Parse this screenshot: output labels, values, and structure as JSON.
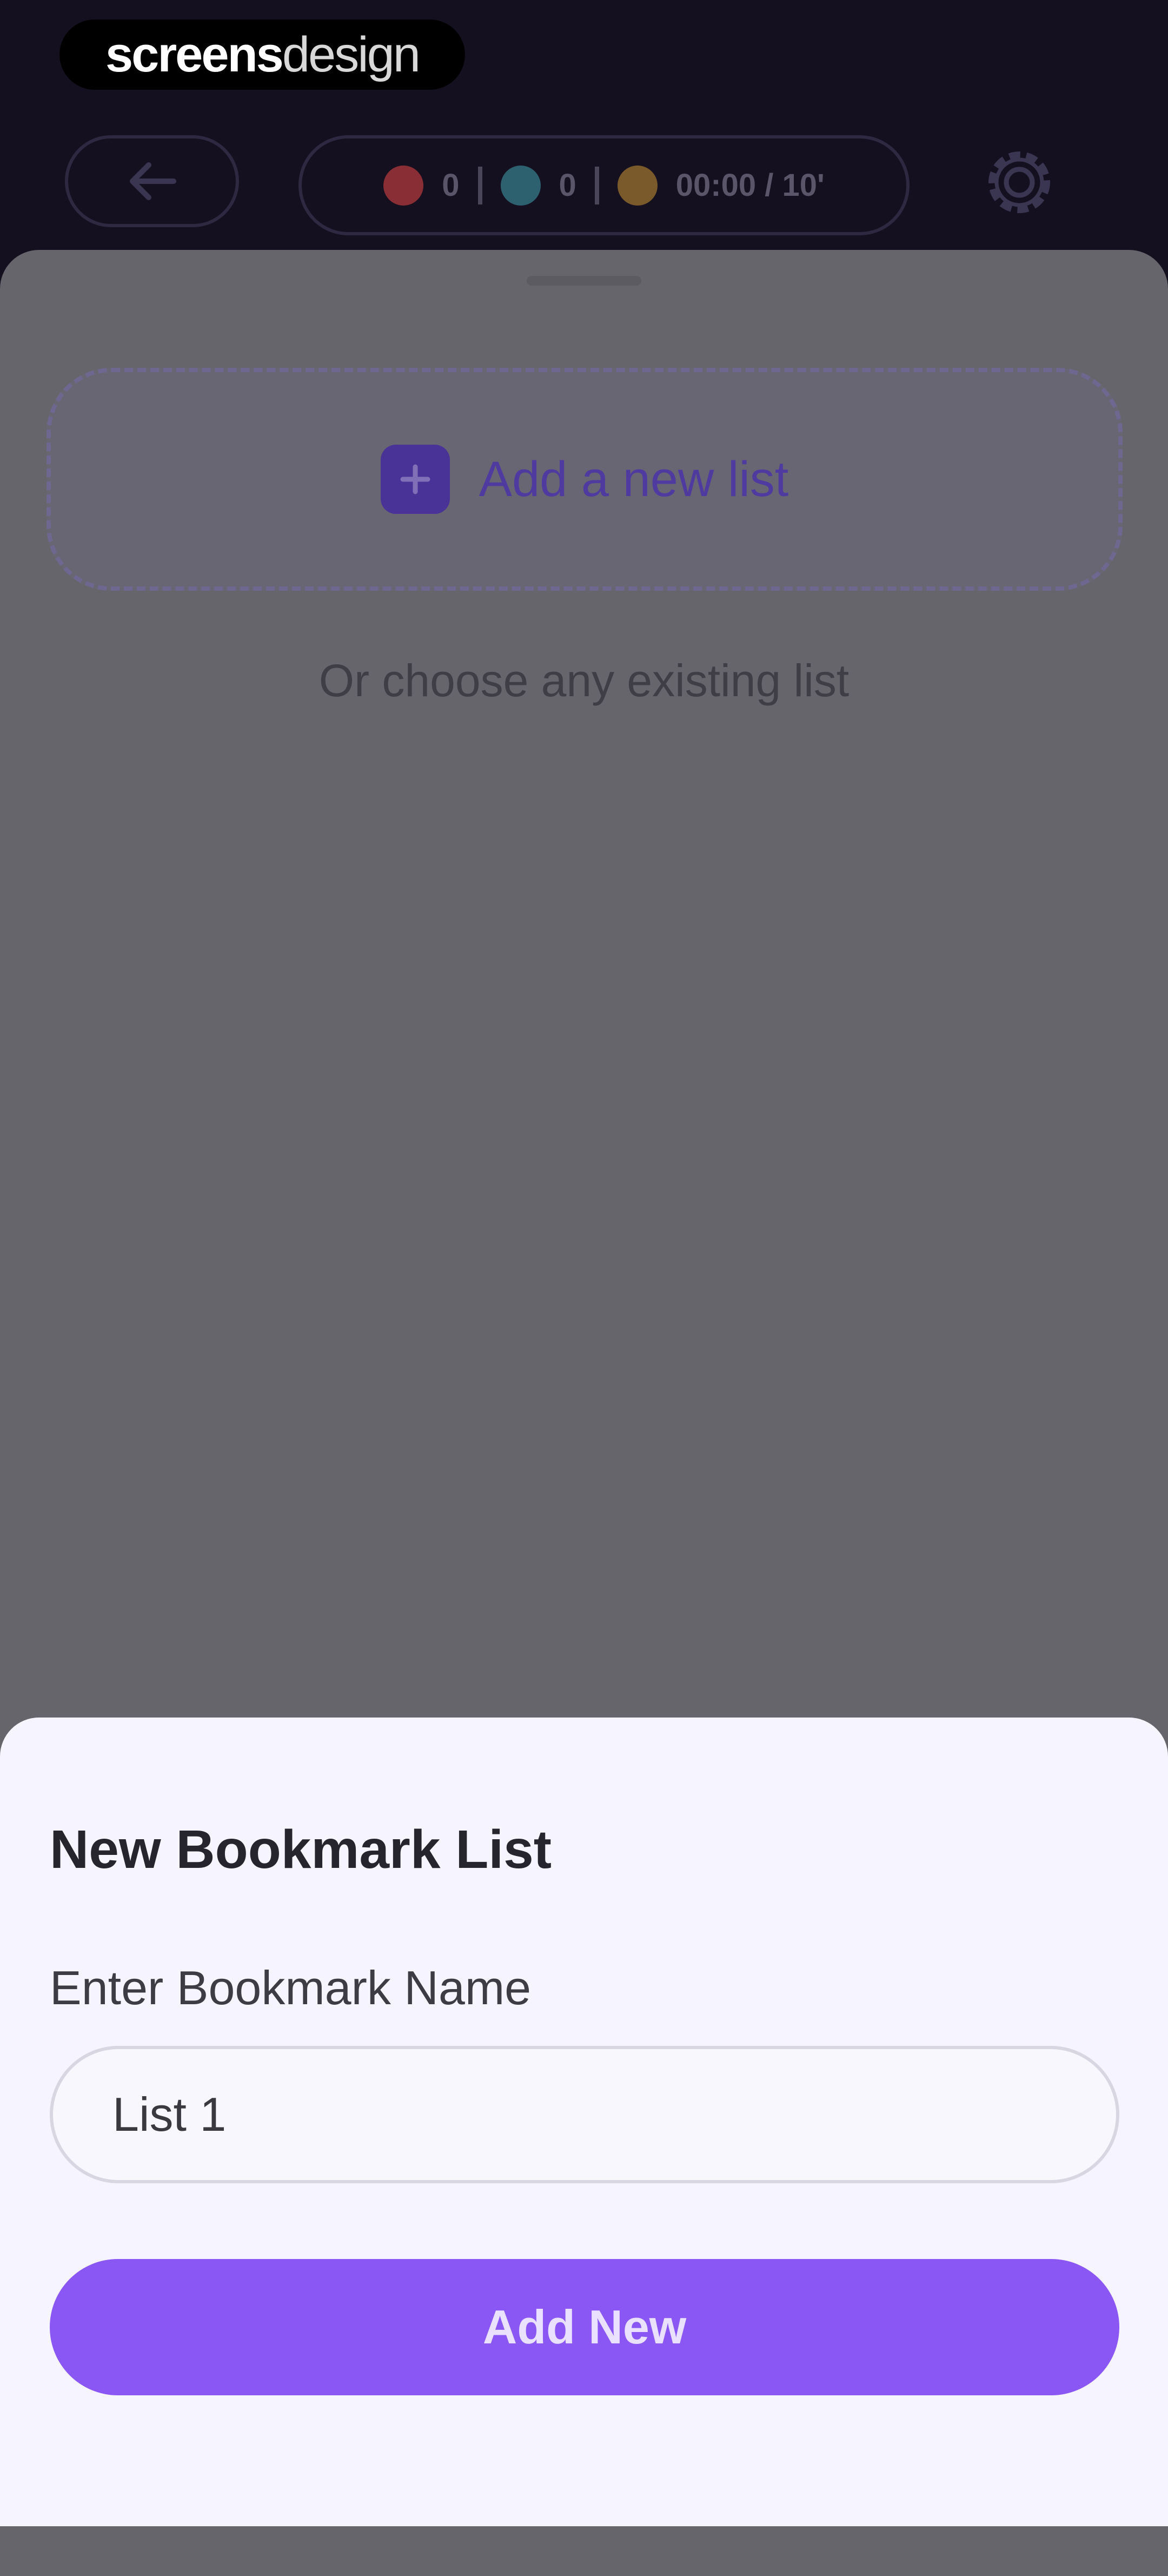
{
  "watermark": {
    "bold": "screens",
    "light": "design"
  },
  "header": {
    "stats": [
      {
        "icon": "fire-icon",
        "value": "0",
        "color": "#8a2e35"
      },
      {
        "icon": "gem-icon",
        "value": "0",
        "color": "#2e6170"
      },
      {
        "icon": "coin-icon",
        "value": "00:00 / 10'",
        "color": "#7a5a2a"
      }
    ]
  },
  "sheet": {
    "add_list_label": "Add a new list",
    "existing_list_text": "Or choose any existing list"
  },
  "modal": {
    "title": "New Bookmark List",
    "field_label": "Enter Bookmark Name",
    "input_value": "List 1",
    "submit_label": "Add New"
  },
  "colors": {
    "accent": "#8a57f5",
    "modal_bg": "#f6f4fe",
    "scrim": "#66656b"
  }
}
